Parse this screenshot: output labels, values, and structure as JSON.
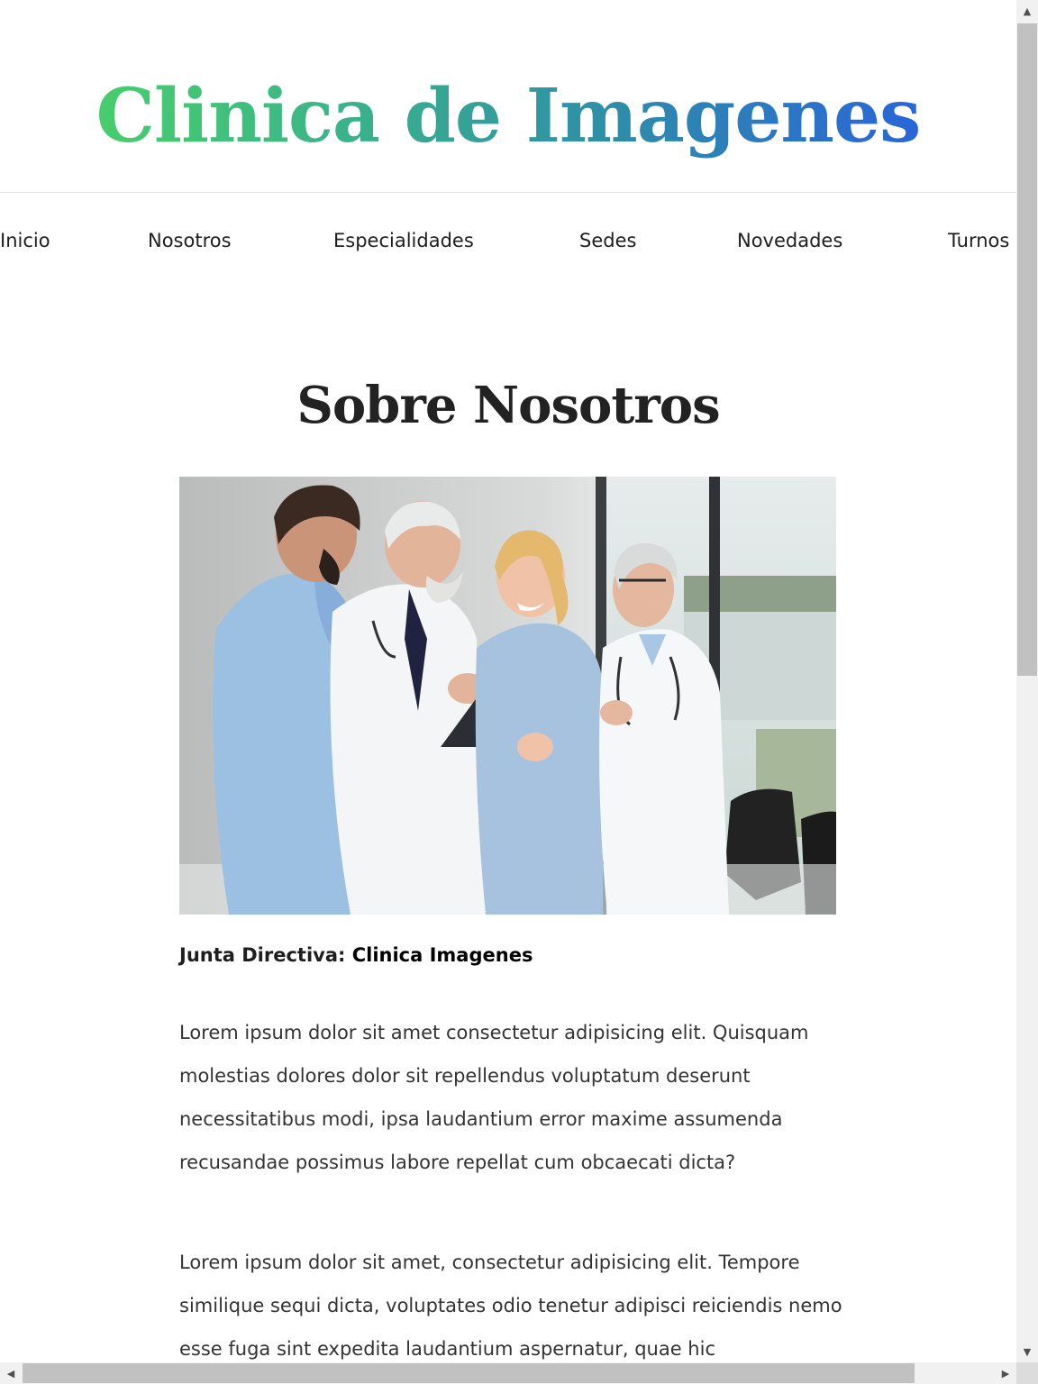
{
  "header": {
    "site_title": "Clinica de Imagenes"
  },
  "nav": {
    "items": [
      {
        "label": "Inicio"
      },
      {
        "label": "Nosotros"
      },
      {
        "label": "Especialidades"
      },
      {
        "label": "Sedes"
      },
      {
        "label": "Novedades"
      },
      {
        "label": "Turnos"
      }
    ]
  },
  "main": {
    "heading": "Sobre Nosotros",
    "photo": {
      "icon": "team-photo-image"
    },
    "caption": {
      "label": "Junta Directiva:",
      "name": "Clinica Imagenes"
    },
    "paragraphs": [
      "Lorem ipsum dolor sit amet consectetur adipisicing elit. Quisquam molestias dolores dolor sit repellendus voluptatum deserunt necessitatibus modi, ipsa laudantium error maxime assumenda recusandae possimus labore repellat cum obcaecati dicta?",
      "Lorem ipsum dolor sit amet, consectetur adipisicing elit. Tempore similique sequi dicta, voluptates odio tenetur adipisci reiciendis nemo esse fuga sint expedita laudantium aspernatur, quae hic"
    ]
  },
  "colors": {
    "title_gradient_start": "#4cd860",
    "title_gradient_end": "#2758e8",
    "text": "#333333",
    "heading": "#222222"
  },
  "scrollbars": {
    "up_icon": "triangle-up-icon",
    "down_icon": "triangle-down-icon",
    "left_icon": "triangle-left-icon",
    "right_icon": "triangle-right-icon"
  }
}
